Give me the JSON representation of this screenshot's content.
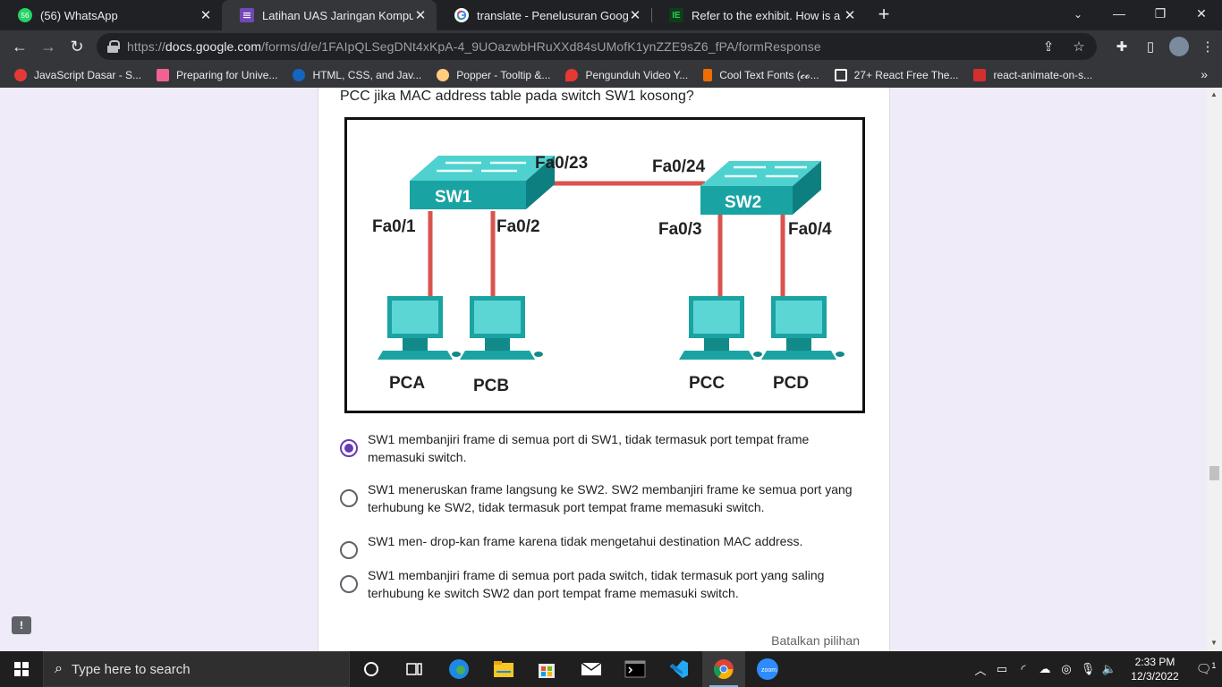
{
  "tabs": [
    {
      "title": "(56) WhatsApp",
      "icon": "whatsapp-icon",
      "badge": "56",
      "color": "#25d366"
    },
    {
      "title": "Latihan UAS Jaringan Komputer L",
      "icon": "google-forms-icon",
      "color": "#7248b9"
    },
    {
      "title": "translate - Penelusuran Google",
      "icon": "google-icon",
      "color": "#ffffff"
    },
    {
      "title": "Refer to the exhibit. How is a fran",
      "icon": "site-icon",
      "color": "#1e8e3e"
    }
  ],
  "url": {
    "prefix": "https://",
    "domain": "docs.google.com",
    "path": "/forms/d/e/1FAIpQLSegDNt4xKpA-4_9UOazwbHRuXXd84sUMofK1ynZZE9sZ6_fPA/formResponse"
  },
  "bookmarks": [
    {
      "label": "JavaScript Dasar - S...",
      "color": "#e53935"
    },
    {
      "label": "Preparing for Unive...",
      "color": "#f06292"
    },
    {
      "label": "HTML, CSS, and Jav...",
      "color": "#1565c0"
    },
    {
      "label": "Popper - Tooltip &...",
      "color": "#ffcc80"
    },
    {
      "label": "Pengunduh Video Y...",
      "color": "#e53935"
    },
    {
      "label": "Cool Text Fonts (𝓬𝓸...",
      "color": "#ef6c00"
    },
    {
      "label": "27+ React Free The...",
      "color": "#ffffff"
    },
    {
      "label": "react-animate-on-s...",
      "color": "#d32f2f"
    }
  ],
  "question": {
    "text": "PCC jika MAC address table pada switch SW1 kosong?"
  },
  "exhibit": {
    "switches": [
      "SW1",
      "SW2"
    ],
    "trunk_ports": [
      "Fa0/23",
      "Fa0/24"
    ],
    "access_ports": [
      "Fa0/1",
      "Fa0/2",
      "Fa0/3",
      "Fa0/4"
    ],
    "pcs": [
      "PCA",
      "PCB",
      "PCC",
      "PCD"
    ],
    "link_color": "#d9534f",
    "device_color": "#2aa7a7"
  },
  "options": [
    {
      "label": "SW1 membanjiri frame di semua port di SW1, tidak termasuk port tempat frame memasuki switch.",
      "checked": true
    },
    {
      "label": "SW1 meneruskan frame langsung ke SW2. SW2 membanjiri frame ke semua port yang terhubung ke SW2, tidak termasuk port tempat frame memasuki switch.",
      "checked": false
    },
    {
      "label": "SW1 men- drop-kan frame karena tidak mengetahui destination MAC address.",
      "checked": false
    },
    {
      "label": "SW1 membanjiri frame di semua port pada switch, tidak termasuk port yang saling terhubung ke switch SW2 dan port tempat frame memasuki switch.",
      "checked": false
    }
  ],
  "clear_selection": "Batalkan pilihan",
  "accent_color": "#673ab7",
  "taskbar": {
    "search_placeholder": "Type here to search",
    "time": "2:33 PM",
    "date": "12/3/2022",
    "notification_count": "1"
  }
}
